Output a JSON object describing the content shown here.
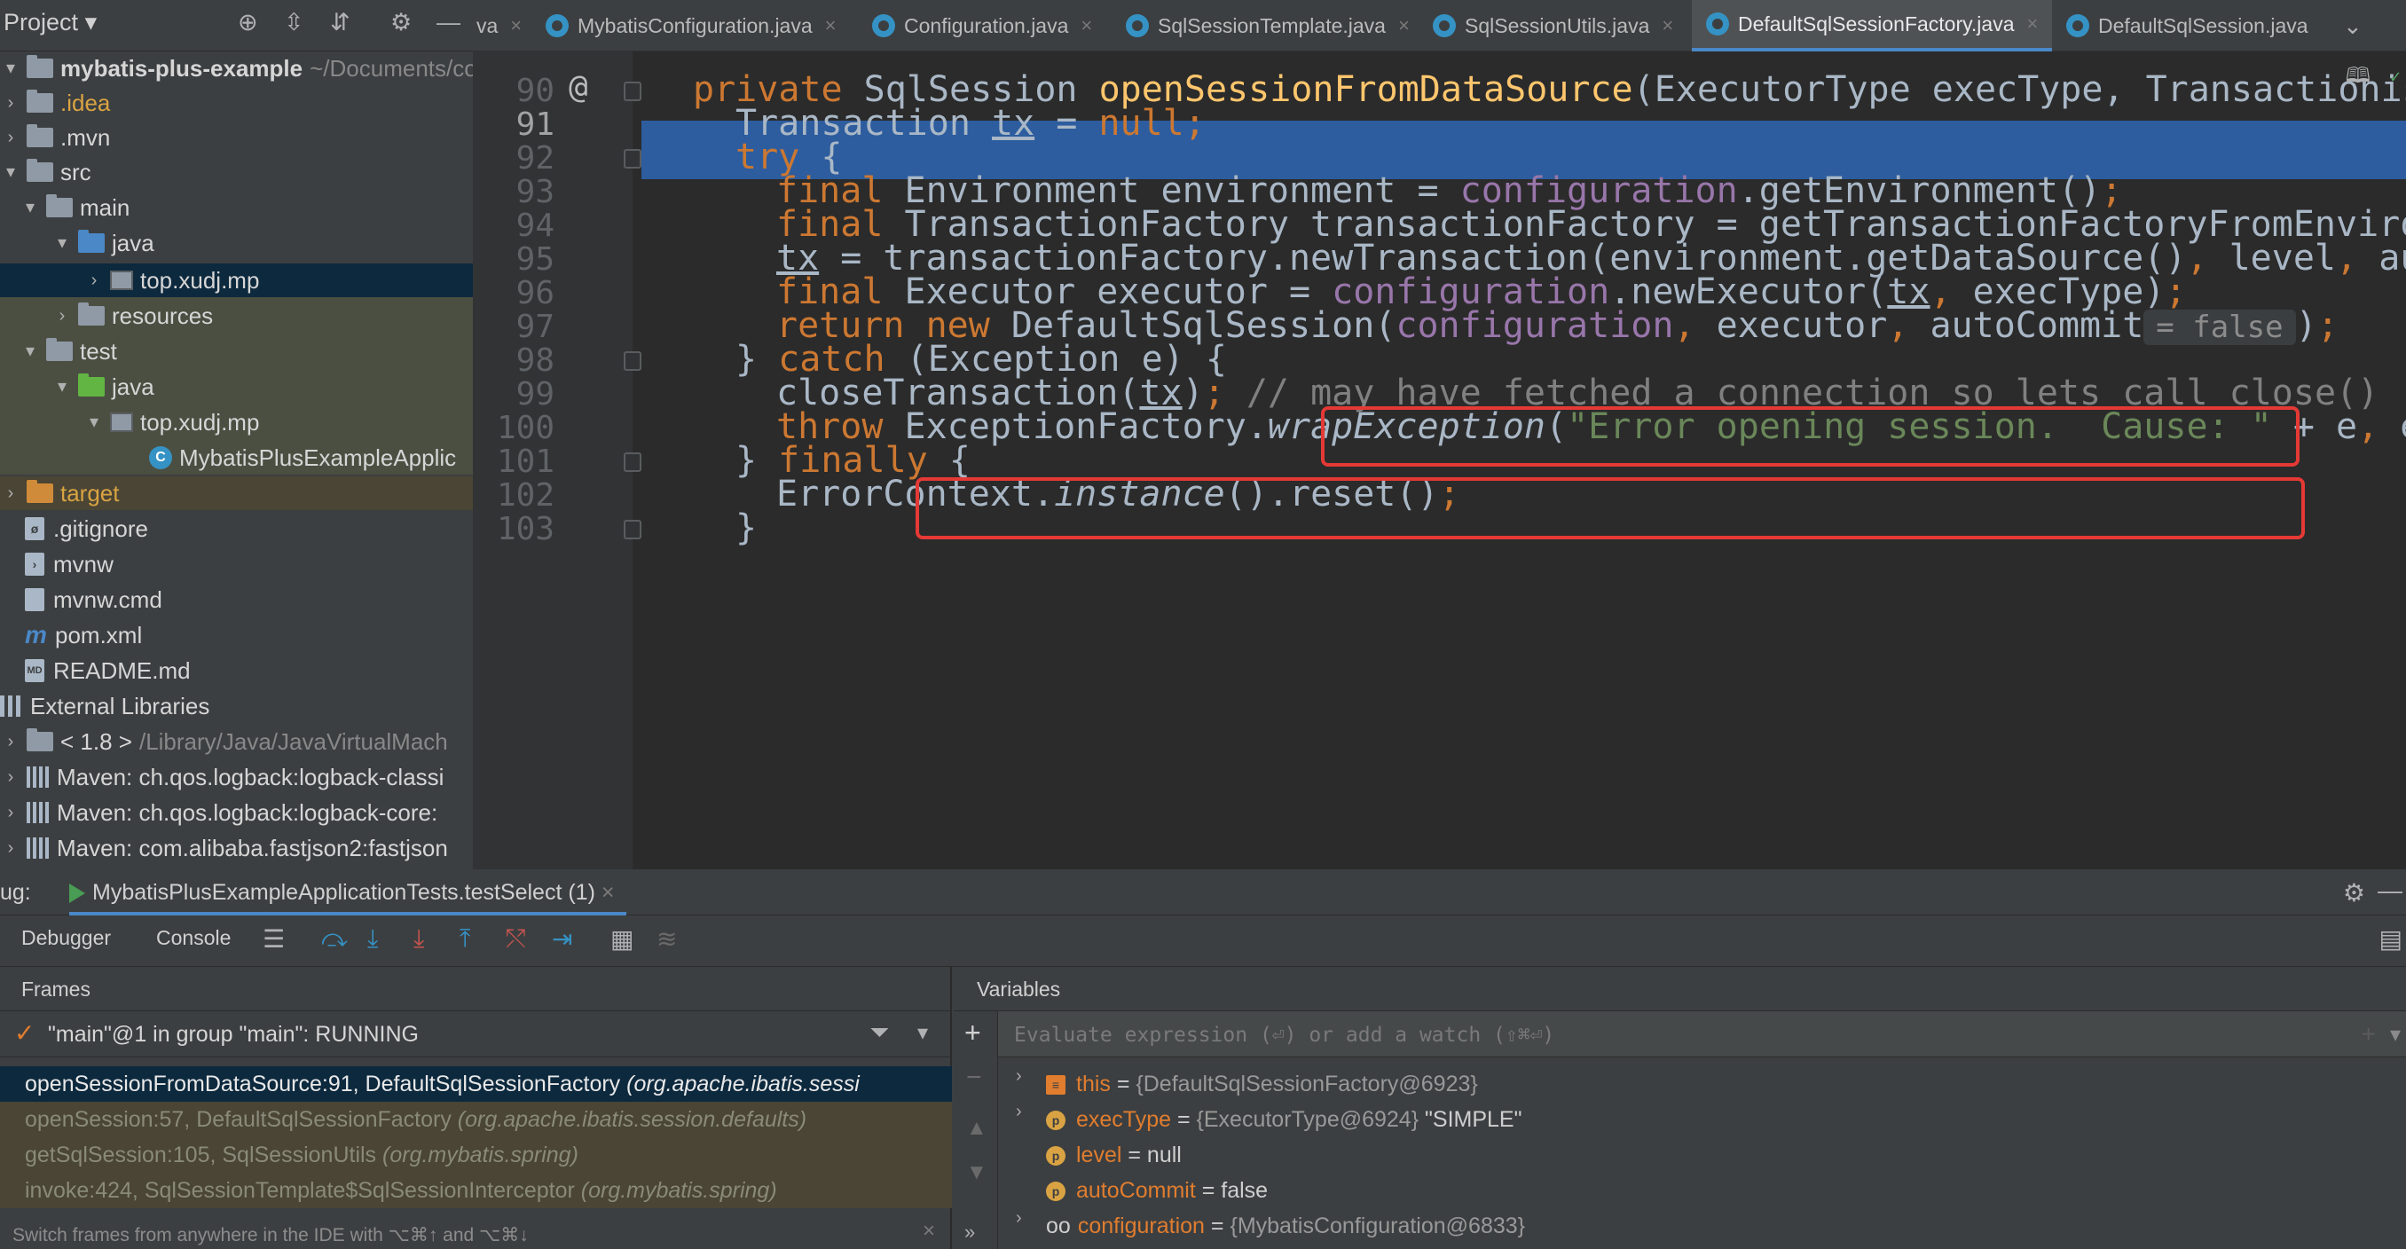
{
  "project_panel": {
    "title": "Project",
    "tree": [
      {
        "label": "mybatis-plus-example",
        "path": "~/Documents/co",
        "bold": true
      },
      {
        "label": ".idea"
      },
      {
        "label": ".mvn"
      },
      {
        "label": "src"
      },
      {
        "label": "main"
      },
      {
        "label": "java"
      },
      {
        "label": "top.xudj.mp"
      },
      {
        "label": "resources"
      },
      {
        "label": "test"
      },
      {
        "label": "java"
      },
      {
        "label": "top.xudj.mp"
      },
      {
        "label": "MybatisPlusExampleApplic"
      },
      {
        "label": "target"
      },
      {
        "label": ".gitignore"
      },
      {
        "label": "mvnw"
      },
      {
        "label": "mvnw.cmd"
      },
      {
        "label": "pom.xml"
      },
      {
        "label": "README.md"
      },
      {
        "label": "External Libraries"
      },
      {
        "label": "< 1.8 >",
        "path": "/Library/Java/JavaVirtualMach"
      },
      {
        "label": "Maven: ch.qos.logback:logback-classi"
      },
      {
        "label": "Maven: ch.qos.logback:logback-core:"
      },
      {
        "label": "Maven: com.alibaba.fastjson2:fastjson"
      }
    ]
  },
  "tabs": [
    {
      "label": "va",
      "active": false
    },
    {
      "label": "MybatisConfiguration.java",
      "active": false
    },
    {
      "label": "Configuration.java",
      "active": false
    },
    {
      "label": "SqlSessionTemplate.java",
      "active": false
    },
    {
      "label": "SqlSessionUtils.java",
      "active": false
    },
    {
      "label": "DefaultSqlSessionFactory.java",
      "active": true
    },
    {
      "label": "DefaultSqlSession.java",
      "active": false
    }
  ],
  "editor": {
    "line_numbers": [
      "90",
      "91",
      "92",
      "93",
      "94",
      "95",
      "96",
      "97",
      "98",
      "99",
      "100",
      "101",
      "102",
      "103"
    ],
    "current_line": "91",
    "at_marker": "@",
    "lines": {
      "l90": {
        "kw": "private ",
        "type": "SqlSession ",
        "fn": "openSessionFromDataSource",
        "rest": "(ExecutorType execType, Transactionis"
      },
      "l91": {
        "text": "Transaction ",
        "var": "tx",
        "eq": " = ",
        "kw": "null",
        "semi": ";"
      },
      "l92": {
        "kw": "try",
        "rest": " {"
      },
      "l93": {
        "kw": "final ",
        "a": "Environment environment = ",
        "fld": "configuration",
        "b": ".getEnvironment()",
        "semi": ";"
      },
      "l94": {
        "kw": "final ",
        "a": "TransactionFactory transactionFactory = getTransactionFactoryFromEnviro"
      },
      "l95": {
        "var": "tx",
        "a": " = transactionFactory.newTransaction(environment.getDataSource()",
        "comma": ", ",
        "b": "level",
        "comma2": ", ",
        "c": "au"
      },
      "l96": {
        "kw": "final ",
        "a": "Executor executor = ",
        "fld": "configuration",
        "b": ".newExecutor(",
        "var": "tx",
        "comma": ", ",
        "c": "execType)",
        "semi": ";"
      },
      "l97": {
        "kw": "return ",
        "kw2": "new ",
        "a": "DefaultSqlSession(",
        "fld": "configuration",
        "comma": ", ",
        "b": "executor",
        "comma2": ", ",
        "c": "autoCommit",
        "hint": "= false",
        "d": ")",
        "semi": ";"
      },
      "l98": {
        "a": "} ",
        "kw": "catch",
        "b": " (Exception e) {"
      },
      "l99": {
        "a": "closeTransaction(",
        "var": "tx",
        "b": ")",
        "semi": "; ",
        "cmt": "// may have fetched a connection so lets call close()"
      },
      "l100": {
        "kw": "throw ",
        "a": "ExceptionFactory.",
        "it": "wrapException",
        "b": "(",
        "str": "\"Error opening session.  Cause: \"",
        "c": " + e",
        "comma": ", ",
        "d": "e"
      },
      "l101": {
        "a": "} ",
        "kw": "finally",
        "b": " {"
      },
      "l102": {
        "a": "ErrorContext.",
        "it": "instance",
        "b": "().reset()",
        "semi": ";"
      },
      "l103": {
        "a": "}"
      }
    }
  },
  "debug": {
    "label": "ug:",
    "session_tab": "MybatisPlusExampleApplicationTests.testSelect (1)",
    "tabs": [
      "Debugger",
      "Console"
    ],
    "frames_title": "Frames",
    "thread": "\"main\"@1 in group \"main\": RUNNING",
    "frames": [
      {
        "method": "openSessionFromDataSource:91, DefaultSqlSessionFactory",
        "pkg": "(org.apache.ibatis.sessi",
        "selected": true
      },
      {
        "method": "openSession:57, DefaultSqlSessionFactory",
        "pkg": "(org.apache.ibatis.session.defaults)",
        "selected": false
      },
      {
        "method": "getSqlSession:105, SqlSessionUtils",
        "pkg": "(org.mybatis.spring)",
        "selected": false
      },
      {
        "method": "invoke:424, SqlSessionTemplate$SqlSessionInterceptor",
        "pkg": "(org.mybatis.spring)",
        "selected": false
      }
    ],
    "frames_hint": "Switch frames from anywhere in the IDE with ⌥⌘↑ and ⌥⌘↓",
    "variables_title": "Variables",
    "eval_placeholder": "Evaluate expression (⏎) or add a watch (⇧⌘⏎)",
    "variables": [
      {
        "name": "this",
        "eq": " = ",
        "value": "{DefaultSqlSessionFactory@6923}",
        "str": "",
        "expandable": true,
        "icon": "list"
      },
      {
        "name": "execType",
        "eq": " = ",
        "value": "{ExecutorType@6924}",
        "str": " \"SIMPLE\"",
        "expandable": true,
        "icon": "p"
      },
      {
        "name": "level",
        "eq": " = ",
        "value": "null",
        "str": "",
        "expandable": false,
        "icon": "p"
      },
      {
        "name": "autoCommit",
        "eq": " = ",
        "value": "false",
        "str": "",
        "expandable": false,
        "icon": "p"
      },
      {
        "name": "configuration",
        "eq": " = ",
        "value": "{MybatisConfiguration@6833}",
        "str": "",
        "expandable": true,
        "icon": "oo"
      }
    ]
  },
  "colors": {
    "keyword": "#cc7832",
    "method_decl": "#ffc66d",
    "field": "#9876aa",
    "string": "#6a8759",
    "comment": "#808080",
    "execution_line": "#2d5d9e",
    "highlight_box": "#e53935"
  }
}
